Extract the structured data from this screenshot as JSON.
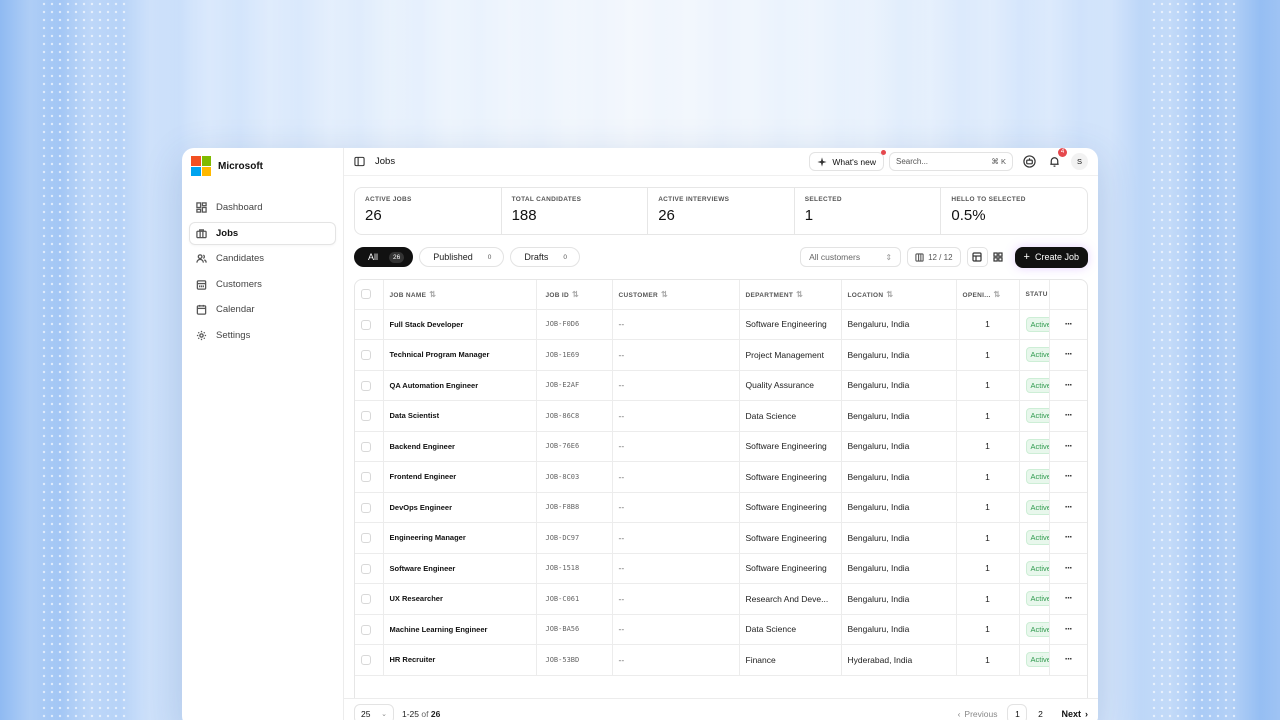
{
  "brand": {
    "name": "Microsoft",
    "logo_colors": [
      "#f25022",
      "#7fba00",
      "#00a4ef",
      "#ffb900"
    ]
  },
  "sidebar": {
    "items": [
      {
        "label": "Dashboard",
        "icon": "dashboard-icon",
        "active": false
      },
      {
        "label": "Jobs",
        "icon": "briefcase-icon",
        "active": true
      },
      {
        "label": "Candidates",
        "icon": "users-icon",
        "active": false
      },
      {
        "label": "Customers",
        "icon": "building-icon",
        "active": false
      },
      {
        "label": "Calendar",
        "icon": "calendar-icon",
        "active": false
      },
      {
        "label": "Settings",
        "icon": "gear-icon",
        "active": false
      }
    ]
  },
  "topbar": {
    "title": "Jobs",
    "whats_new": "What's new",
    "search_placeholder": "Search...",
    "search_shortcut": "⌘ K",
    "notification_count": "4",
    "avatar_initial": "S"
  },
  "stats": [
    {
      "label": "ACTIVE JOBS",
      "value": "26"
    },
    {
      "label": "TOTAL CANDIDATES",
      "value": "188"
    },
    {
      "label": "ACTIVE INTERVIEWS",
      "value": "26"
    },
    {
      "label": "SELECTED",
      "value": "1"
    },
    {
      "label": "HELLO TO SELECTED",
      "value": "0.5%"
    }
  ],
  "filters": {
    "tabs": [
      {
        "label": "All",
        "count": "26",
        "active": true
      },
      {
        "label": "Published",
        "count": "0",
        "active": false
      },
      {
        "label": "Drafts",
        "count": "0",
        "active": false
      }
    ],
    "customer_select": "All customers",
    "column_count": "12 / 12",
    "create_label": "Create Job"
  },
  "table": {
    "headers": [
      "JOB NAME",
      "JOB ID",
      "CUSTOMER",
      "DEPARTMENT",
      "LOCATION",
      "OPENI...",
      "STATU"
    ],
    "rows": [
      {
        "name": "Full Stack Developer",
        "id": "JOB-F0D6",
        "customer": "--",
        "department": "Software Engineering",
        "location": "Bengaluru, India",
        "openings": "1",
        "status": "Active"
      },
      {
        "name": "Technical Program Manager",
        "id": "JOB-1E69",
        "customer": "--",
        "department": "Project Management",
        "location": "Bengaluru, India",
        "openings": "1",
        "status": "Active"
      },
      {
        "name": "QA Automation Engineer",
        "id": "JOB-E2AF",
        "customer": "--",
        "department": "Quality Assurance",
        "location": "Bengaluru, India",
        "openings": "1",
        "status": "Active"
      },
      {
        "name": "Data Scientist",
        "id": "JOB-86C8",
        "customer": "--",
        "department": "Data Science",
        "location": "Bengaluru, India",
        "openings": "1",
        "status": "Active"
      },
      {
        "name": "Backend Engineer",
        "id": "JOB-76E6",
        "customer": "--",
        "department": "Software Engineering",
        "location": "Bengaluru, India",
        "openings": "1",
        "status": "Active"
      },
      {
        "name": "Frontend Engineer",
        "id": "JOB-8C03",
        "customer": "--",
        "department": "Software Engineering",
        "location": "Bengaluru, India",
        "openings": "1",
        "status": "Active"
      },
      {
        "name": "DevOps Engineer",
        "id": "JOB-F8B8",
        "customer": "--",
        "department": "Software Engineering",
        "location": "Bengaluru, India",
        "openings": "1",
        "status": "Active"
      },
      {
        "name": "Engineering Manager",
        "id": "JOB-DC97",
        "customer": "--",
        "department": "Software Engineering",
        "location": "Bengaluru, India",
        "openings": "1",
        "status": "Active"
      },
      {
        "name": "Software Engineer",
        "id": "JOB-1518",
        "customer": "--",
        "department": "Software Engineering",
        "location": "Bengaluru, India",
        "openings": "1",
        "status": "Active"
      },
      {
        "name": "UX Researcher",
        "id": "JOB-C061",
        "customer": "--",
        "department": "Research And Deve...",
        "location": "Bengaluru, India",
        "openings": "1",
        "status": "Active"
      },
      {
        "name": "Machine Learning Engineer",
        "id": "JOB-BA56",
        "customer": "--",
        "department": "Data Science",
        "location": "Bengaluru, India",
        "openings": "1",
        "status": "Active"
      },
      {
        "name": "HR Recruiter",
        "id": "JOB-53BD",
        "customer": "--",
        "department": "Finance",
        "location": "Hyderabad, India",
        "openings": "1",
        "status": "Active"
      }
    ]
  },
  "pagination": {
    "page_size": "25",
    "range_prefix": "1-25",
    "range_of": "of",
    "total": "26",
    "previous": "Previous",
    "pages": [
      "1",
      "2"
    ],
    "next": "Next"
  }
}
